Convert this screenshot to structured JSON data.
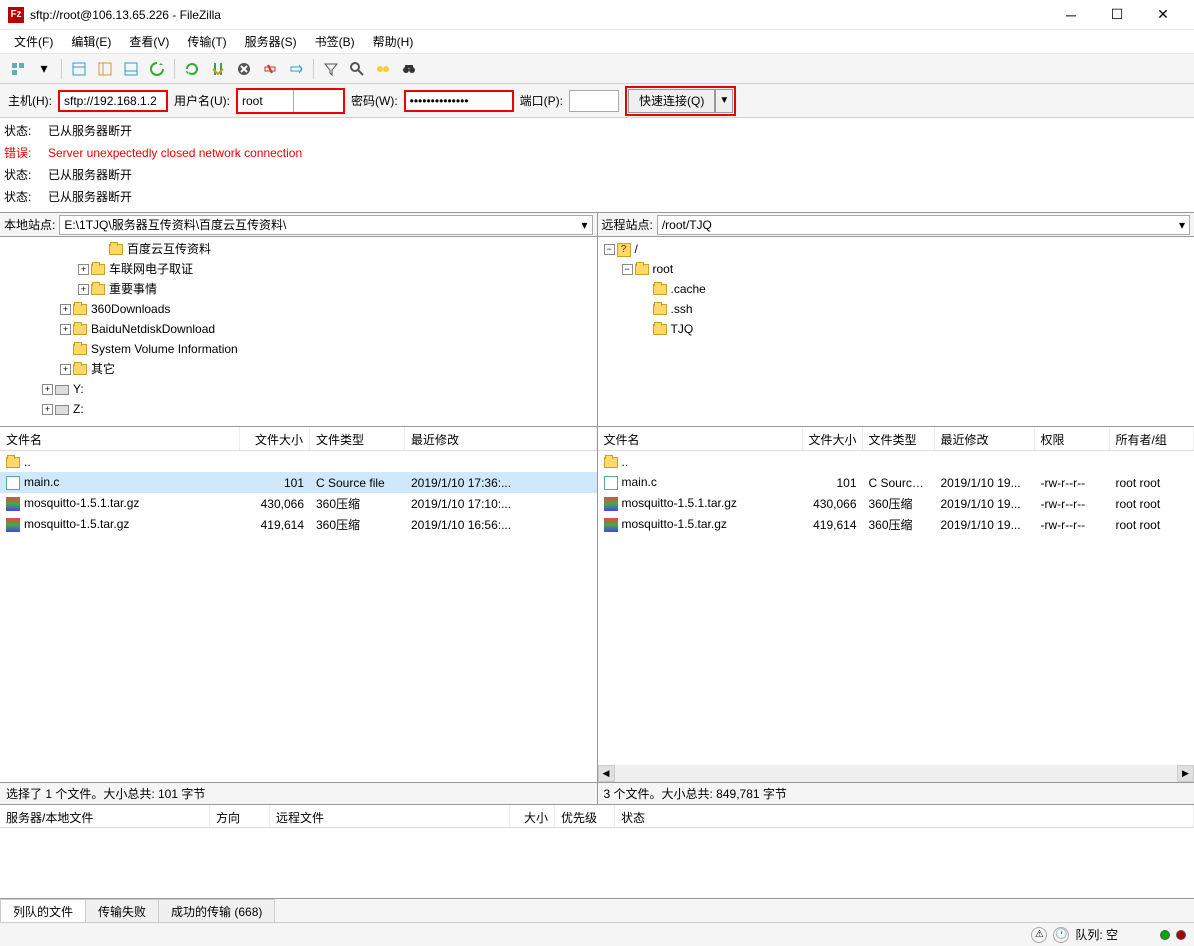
{
  "titlebar": {
    "title": "sftp://root@106.13.65.226 - FileZilla"
  },
  "menu": {
    "file": "文件(F)",
    "edit": "编辑(E)",
    "view": "查看(V)",
    "transfer": "传输(T)",
    "server": "服务器(S)",
    "bookmarks": "书签(B)",
    "help": "帮助(H)"
  },
  "quickconnect": {
    "host_label": "主机(H):",
    "host": "sftp://192.168.1.2",
    "user_label": "用户名(U):",
    "user": "root",
    "pass_label": "密码(W):",
    "pass": "••••••••••••••",
    "port_label": "端口(P):",
    "port": "",
    "button": "快速连接(Q)"
  },
  "log": [
    {
      "type": "status",
      "label": "状态:",
      "text": "已从服务器断开"
    },
    {
      "type": "error",
      "label": "错误:",
      "text": "Server unexpectedly closed network connection"
    },
    {
      "type": "status",
      "label": "状态:",
      "text": "已从服务器断开"
    },
    {
      "type": "status",
      "label": "状态:",
      "text": "已从服务器断开"
    }
  ],
  "local": {
    "label": "本地站点:",
    "path": "E:\\1TJQ\\服务器互传资料\\百度云互传资料\\",
    "tree": [
      {
        "indent": 5,
        "expander": "",
        "icon": "folder",
        "name": "百度云互传资料"
      },
      {
        "indent": 4,
        "expander": "+",
        "icon": "folder",
        "name": "车联网电子取证"
      },
      {
        "indent": 4,
        "expander": "+",
        "icon": "folder",
        "name": "重要事情"
      },
      {
        "indent": 3,
        "expander": "+",
        "icon": "folder",
        "name": "360Downloads"
      },
      {
        "indent": 3,
        "expander": "+",
        "icon": "folder",
        "name": "BaiduNetdiskDownload"
      },
      {
        "indent": 3,
        "expander": "",
        "icon": "folder",
        "name": "System Volume Information"
      },
      {
        "indent": 3,
        "expander": "+",
        "icon": "folder",
        "name": "其它"
      },
      {
        "indent": 2,
        "expander": "+",
        "icon": "drive",
        "name": "Y:"
      },
      {
        "indent": 2,
        "expander": "+",
        "icon": "drive",
        "name": "Z:"
      }
    ],
    "cols": {
      "name": "文件名",
      "size": "文件大小",
      "type": "文件类型",
      "modified": "最近修改"
    },
    "files": [
      {
        "name": "..",
        "size": "",
        "type": "",
        "modified": "",
        "icon": "folder",
        "selected": false
      },
      {
        "name": "main.c",
        "size": "101",
        "type": "C Source file",
        "modified": "2019/1/10 17:36:...",
        "icon": "c",
        "selected": true
      },
      {
        "name": "mosquitto-1.5.1.tar.gz",
        "size": "430,066",
        "type": "360压缩",
        "modified": "2019/1/10 17:10:...",
        "icon": "archive",
        "selected": false
      },
      {
        "name": "mosquitto-1.5.tar.gz",
        "size": "419,614",
        "type": "360压缩",
        "modified": "2019/1/10 16:56:...",
        "icon": "archive",
        "selected": false
      }
    ],
    "summary": "选择了 1 个文件。大小总共: 101 字节"
  },
  "remote": {
    "label": "远程站点:",
    "path": "/root/TJQ",
    "tree": [
      {
        "indent": 0,
        "expander": "−",
        "icon": "q",
        "name": "/"
      },
      {
        "indent": 1,
        "expander": "−",
        "icon": "folder",
        "name": "root"
      },
      {
        "indent": 2,
        "expander": "",
        "icon": "folder",
        "name": ".cache"
      },
      {
        "indent": 2,
        "expander": "",
        "icon": "folder",
        "name": ".ssh"
      },
      {
        "indent": 2,
        "expander": "",
        "icon": "folder",
        "name": "TJQ"
      }
    ],
    "cols": {
      "name": "文件名",
      "size": "文件大小",
      "type": "文件类型",
      "modified": "最近修改",
      "perms": "权限",
      "owner": "所有者/组"
    },
    "files": [
      {
        "name": "..",
        "size": "",
        "type": "",
        "modified": "",
        "perms": "",
        "owner": "",
        "icon": "folder"
      },
      {
        "name": "main.c",
        "size": "101",
        "type": "C Source ...",
        "modified": "2019/1/10 19...",
        "perms": "-rw-r--r--",
        "owner": "root root",
        "icon": "c"
      },
      {
        "name": "mosquitto-1.5.1.tar.gz",
        "size": "430,066",
        "type": "360压缩",
        "modified": "2019/1/10 19...",
        "perms": "-rw-r--r--",
        "owner": "root root",
        "icon": "archive"
      },
      {
        "name": "mosquitto-1.5.tar.gz",
        "size": "419,614",
        "type": "360压缩",
        "modified": "2019/1/10 19...",
        "perms": "-rw-r--r--",
        "owner": "root root",
        "icon": "archive"
      }
    ],
    "summary": "3 个文件。大小总共: 849,781 字节"
  },
  "queue": {
    "cols": {
      "serverfile": "服务器/本地文件",
      "direction": "方向",
      "remotefile": "远程文件",
      "size": "大小",
      "priority": "优先级",
      "status": "状态"
    },
    "tabs": {
      "queued": "列队的文件",
      "failed": "传输失败",
      "success": "成功的传输 (668)"
    }
  },
  "statusbar": {
    "queue": "队列: 空"
  }
}
